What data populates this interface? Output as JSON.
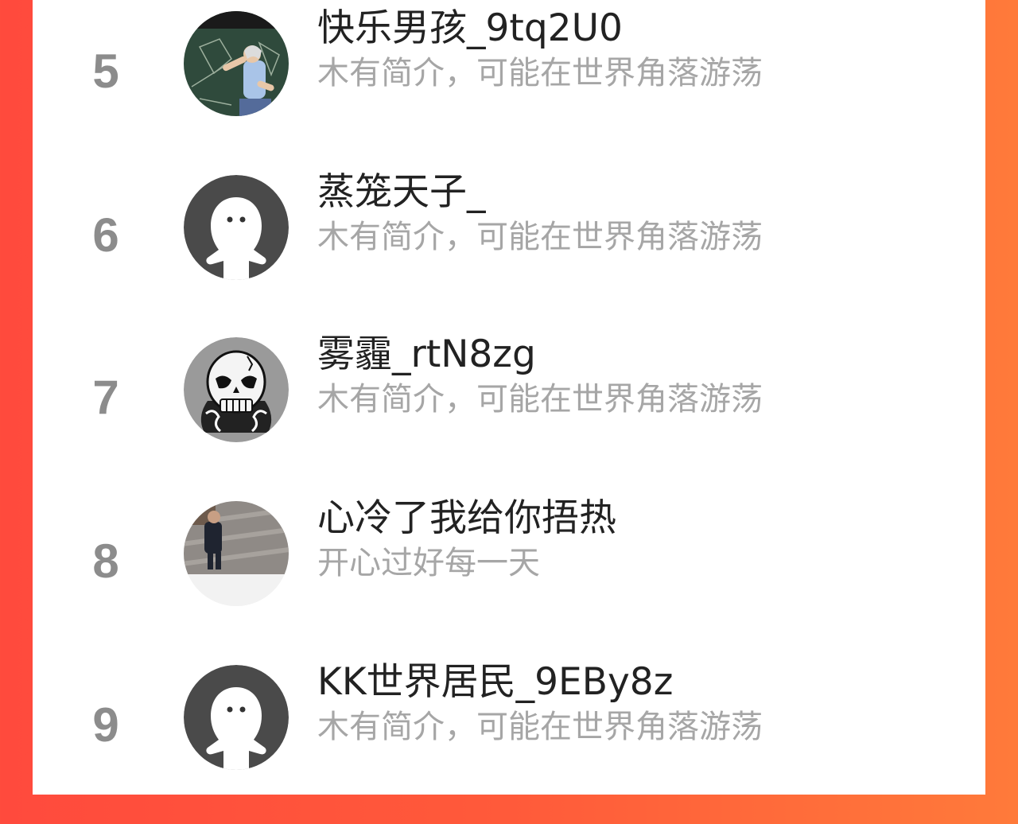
{
  "colors": {
    "background_left": "#ff4a3d",
    "background_right": "#ff7a3a",
    "panel": "#ffffff",
    "rank_text": "#8c8c8c",
    "name_text": "#222222",
    "bio_text": "#a6a6a6",
    "default_avatar_bg": "#4a4a4a"
  },
  "ranking": [
    {
      "rank": "5",
      "name": "快乐男孩_9tq2U0",
      "bio": "木有简介，可能在世界角落游荡",
      "avatar": "teacher-photo-avatar"
    },
    {
      "rank": "6",
      "name": "蒸笼天子_",
      "bio": "木有简介，可能在世界角落游荡",
      "avatar": "default-ghost-avatar"
    },
    {
      "rank": "7",
      "name": "雾霾_rtN8zg",
      "bio": "木有简介，可能在世界角落游荡",
      "avatar": "skull-avatar"
    },
    {
      "rank": "8",
      "name": "心冷了我给你捂热",
      "bio": "开心过好每一天",
      "avatar": "photo-avatar"
    },
    {
      "rank": "9",
      "name": "KK世界居民_9EBy8z",
      "bio": "木有简介，可能在世界角落游荡",
      "avatar": "default-ghost-avatar"
    }
  ]
}
